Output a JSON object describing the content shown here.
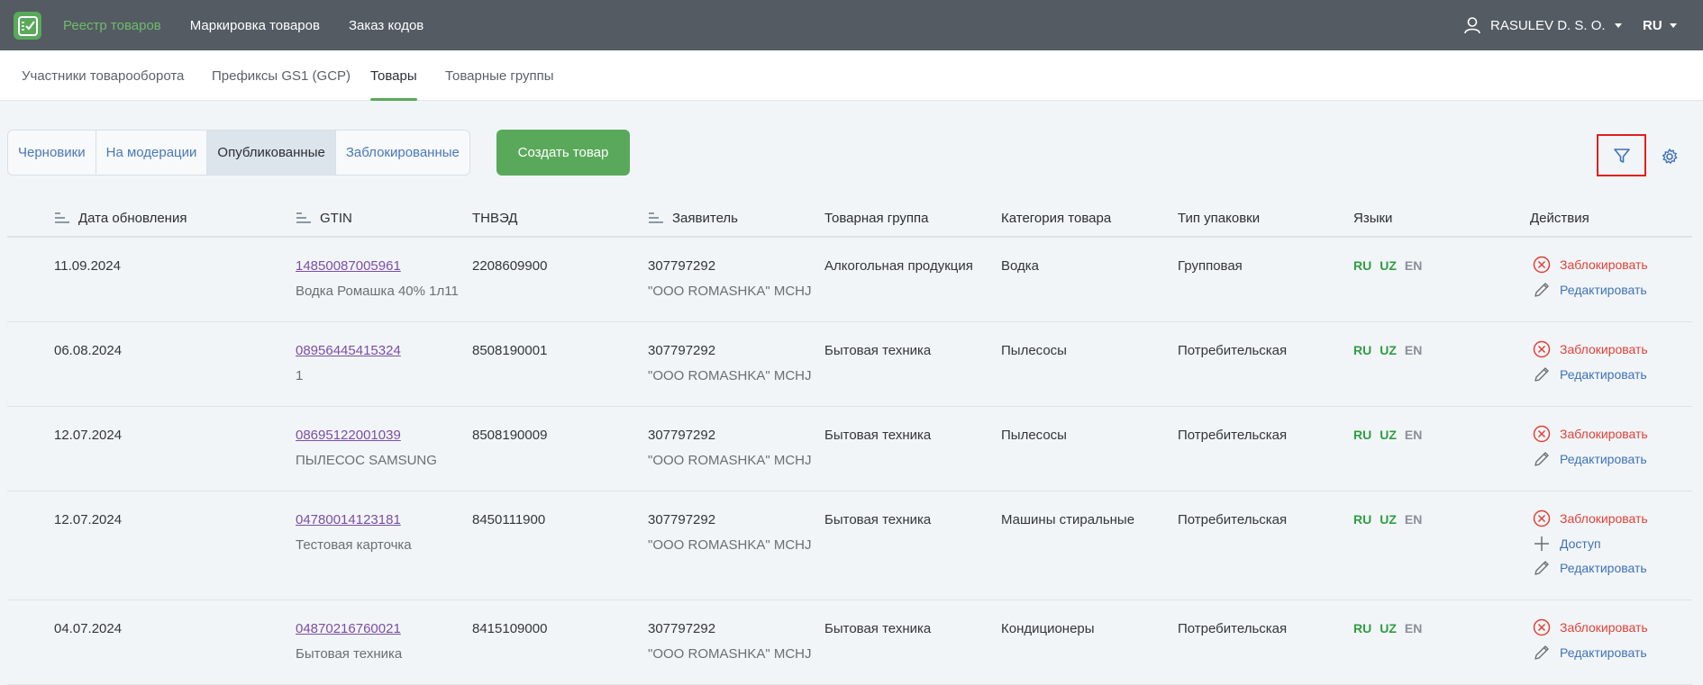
{
  "topbar": {
    "nav": [
      "Реестр товаров",
      "Маркировка товаров",
      "Заказ кодов"
    ],
    "user": "RASULEV D. S. O.",
    "lang": "RU"
  },
  "subnav": [
    "Участники товарооборота",
    "Префиксы GS1 (GCP)",
    "Товары",
    "Товарные группы"
  ],
  "status_tabs": [
    "Черновики",
    "На модерации",
    "Опубликованные",
    "Заблокированные"
  ],
  "create_button": "Создать товар",
  "columns": [
    "Дата обновления",
    "GTIN",
    "ТНВЭД",
    "Заявитель",
    "Товарная группа",
    "Категория товара",
    "Тип упаковки",
    "Языки",
    "Действия"
  ],
  "rows": [
    {
      "date": "11.09.2024",
      "gtin": "14850087005961",
      "name": "Водка Ромашка 40% 1л11",
      "tnved": "2208609900",
      "applicant_id": "307797292",
      "applicant_name": "\"OOO ROMASHKA\" MCHJ",
      "group": "Алкогольная продукция",
      "category": "Водка",
      "package": "Групповая",
      "langs": [
        "RU",
        "UZ",
        "EN"
      ]
    },
    {
      "date": "06.08.2024",
      "gtin": "08956445415324",
      "name": "1",
      "tnved": "8508190001",
      "applicant_id": "307797292",
      "applicant_name": "\"OOO ROMASHKA\" MCHJ",
      "group": "Бытовая техника",
      "category": "Пылесосы",
      "package": "Потребительская",
      "langs": [
        "RU",
        "UZ",
        "EN"
      ]
    },
    {
      "date": "12.07.2024",
      "gtin": "08695122001039",
      "name": "ПЫЛЕСОС SAMSUNG",
      "tnved": "8508190009",
      "applicant_id": "307797292",
      "applicant_name": "\"OOO ROMASHKA\" MCHJ",
      "group": "Бытовая техника",
      "category": "Пылесосы",
      "package": "Потребительская",
      "langs": [
        "RU",
        "UZ",
        "EN"
      ]
    },
    {
      "date": "12.07.2024",
      "gtin": "04780014123181",
      "name": "Тестовая карточка",
      "tnved": "8450111900",
      "applicant_id": "307797292",
      "applicant_name": "\"OOO ROMASHKA\" MCHJ",
      "group": "Бытовая техника",
      "category": "Машины стиральные",
      "package": "Потребительская",
      "langs": [
        "RU",
        "UZ",
        "EN"
      ]
    },
    {
      "date": "04.07.2024",
      "gtin": "04870216760021",
      "name": "Бытовая техника",
      "tnved": "8415109000",
      "applicant_id": "307797292",
      "applicant_name": "\"OOO ROMASHKA\" MCHJ",
      "group": "Бытовая техника",
      "category": "Кондиционеры",
      "package": "Потребительская",
      "langs": [
        "RU",
        "UZ",
        "EN"
      ]
    }
  ],
  "actions": {
    "block": "Заблокировать",
    "access": "Доступ",
    "edit": "Редактировать"
  },
  "colors": {
    "accent": "#5aa95b",
    "topbar": "#545b63",
    "link": "#3f72b8",
    "danger": "#e0413a",
    "gtin": "#7b4ea6",
    "lang_on": "#2f9e44"
  }
}
